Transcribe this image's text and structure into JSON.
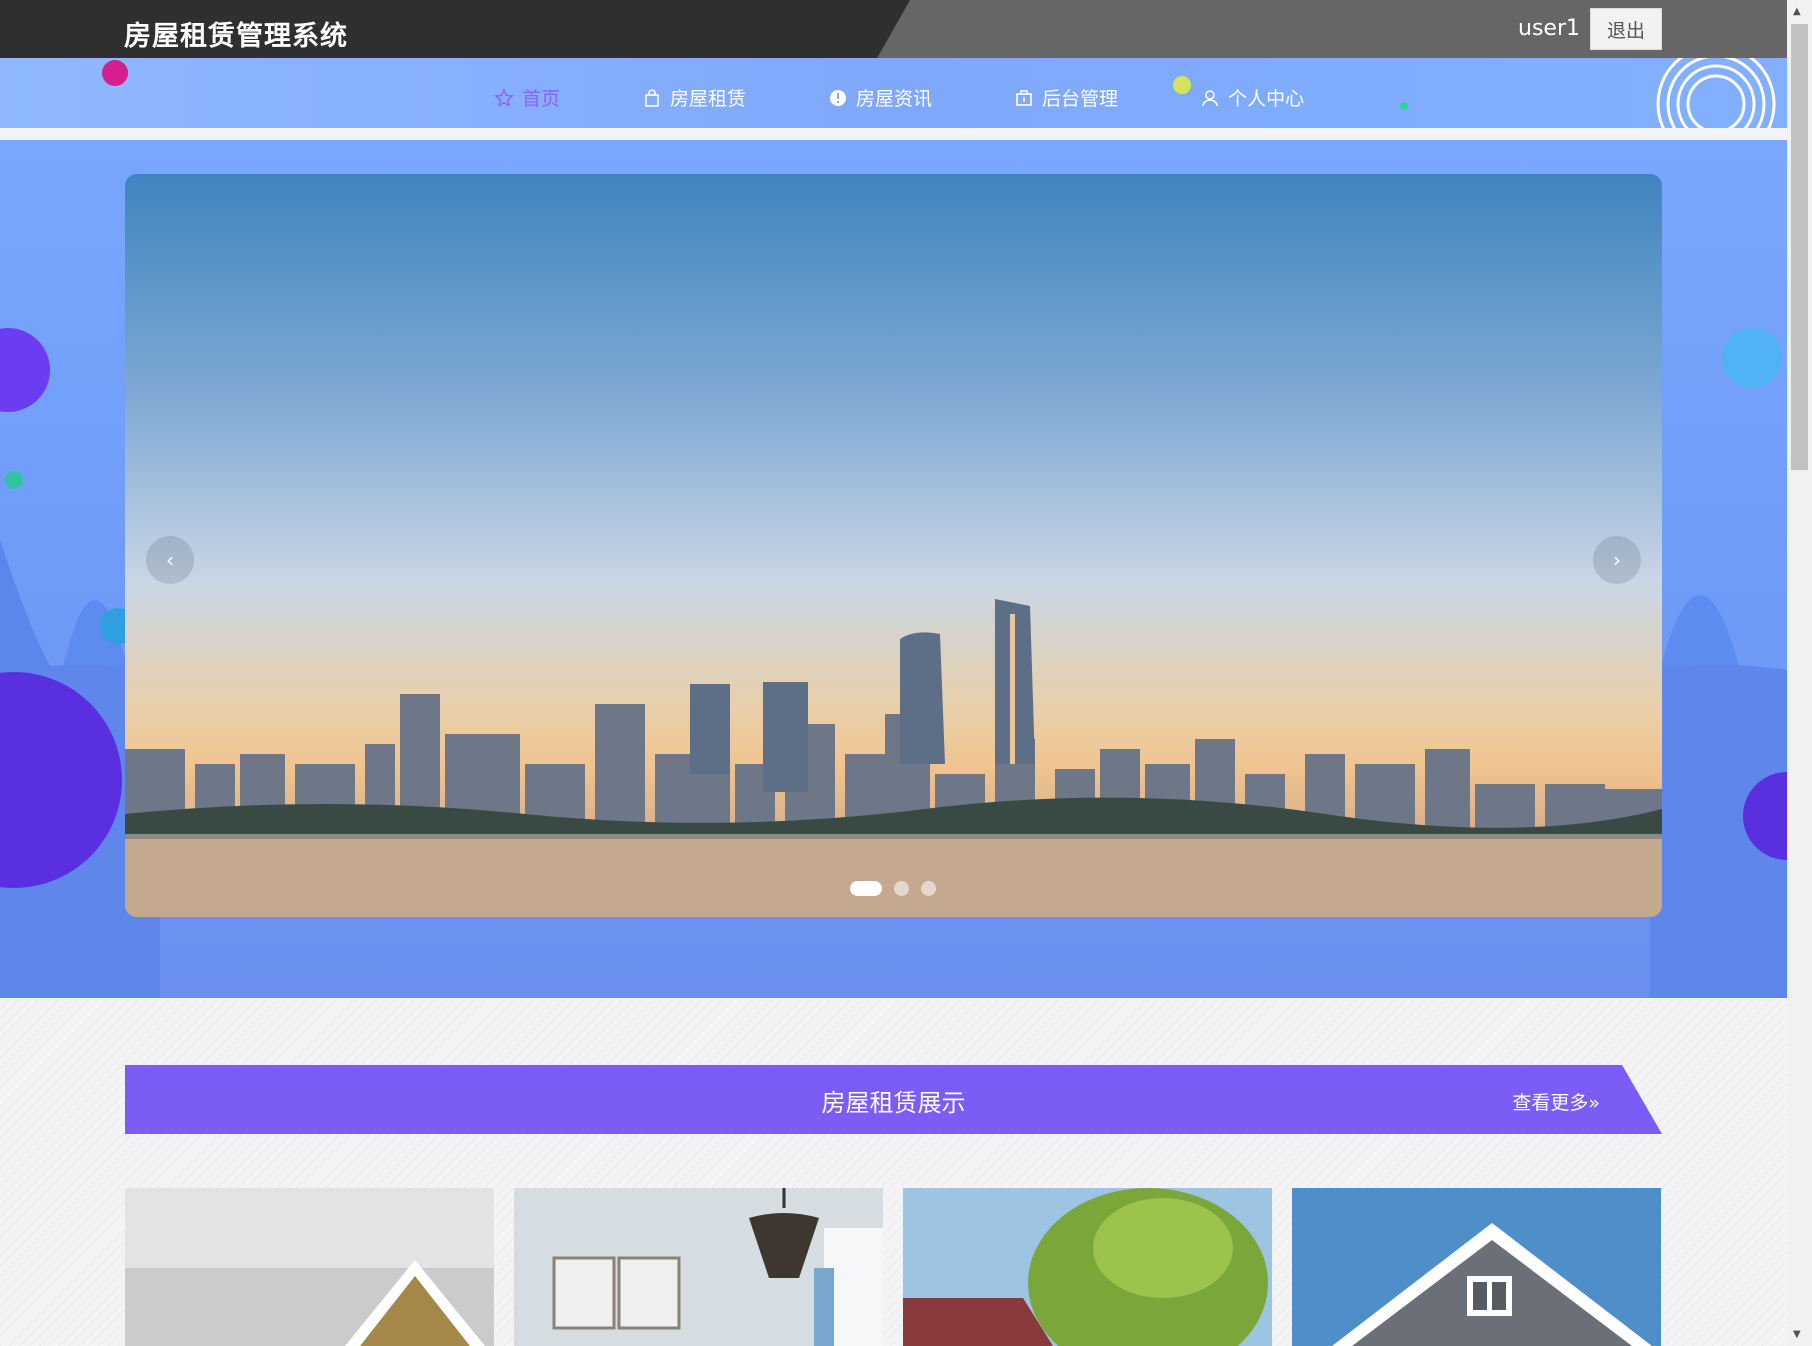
{
  "header": {
    "title": "房屋租赁管理系统",
    "username": "user1",
    "logout_label": "退出"
  },
  "nav": {
    "items": [
      {
        "label": "首页",
        "icon": "star-icon",
        "active": true
      },
      {
        "label": "房屋租赁",
        "icon": "bag-icon",
        "active": false
      },
      {
        "label": "房屋资讯",
        "icon": "info-icon",
        "active": false
      },
      {
        "label": "后台管理",
        "icon": "briefcase-icon",
        "active": false
      },
      {
        "label": "个人中心",
        "icon": "user-icon",
        "active": false
      }
    ]
  },
  "carousel": {
    "prev_label": "‹",
    "next_label": "›",
    "slide_count": 3,
    "active_slide": 1
  },
  "section": {
    "title": "房屋租赁展示",
    "more_label": "查看更多»"
  },
  "colors": {
    "accent": "#7b5cf5",
    "nav_active": "#8a63ff",
    "header_dark": "#2f2f2f"
  }
}
